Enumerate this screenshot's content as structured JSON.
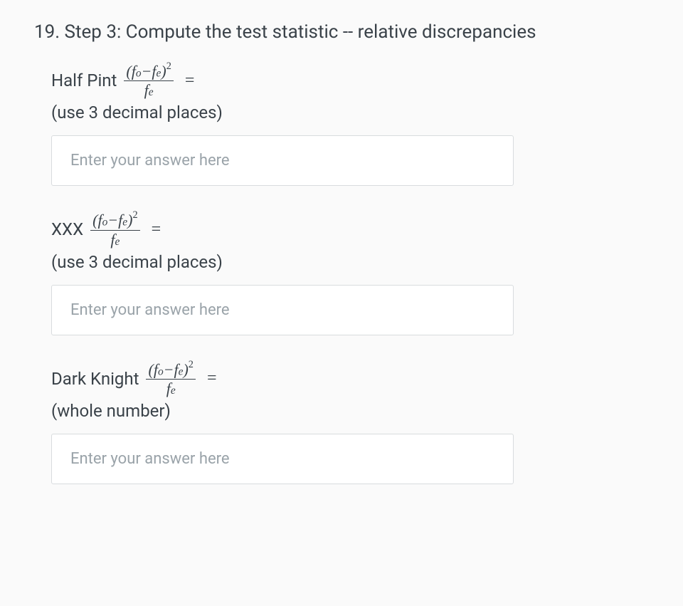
{
  "question": {
    "number": "19.",
    "title": "Step 3: Compute the test statistic -- relative discrepancies"
  },
  "formula": {
    "numerator_open": "(",
    "fo": "f",
    "o_sub": "o",
    "minus": "−",
    "fe": "f",
    "e_sub": "e",
    "numerator_close": ")",
    "exponent": "2",
    "denominator_f": "f",
    "denominator_e": "e"
  },
  "equals": "=",
  "subquestions": [
    {
      "label": "Half Pint",
      "hint": "(use 3 decimal places)",
      "placeholder": "Enter your answer here"
    },
    {
      "label": "XXX",
      "hint": "(use 3 decimal places)",
      "placeholder": "Enter your answer here"
    },
    {
      "label": "Dark Knight",
      "hint": "(whole number)",
      "placeholder": "Enter your answer here"
    }
  ]
}
